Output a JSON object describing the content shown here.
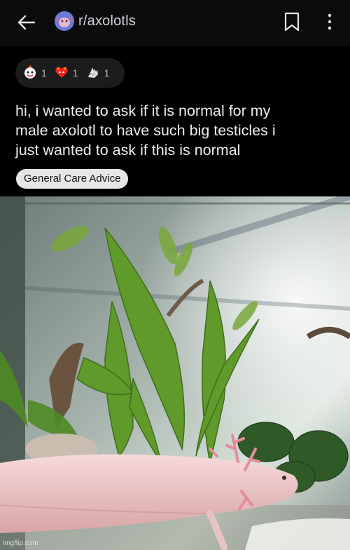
{
  "header": {
    "subreddit": "r/axolotls",
    "icons": {
      "back": "back-arrow-icon",
      "avatar": "subreddit-avatar-icon",
      "save": "bookmark-icon",
      "more": "more-options-icon"
    }
  },
  "awards": [
    {
      "icon": "award-face-icon",
      "count": "1"
    },
    {
      "icon": "award-heart-icon",
      "count": "1"
    },
    {
      "icon": "award-hand-icon",
      "count": "1"
    }
  ],
  "post": {
    "title_lines": [
      "hi, i wanted to ask if it is normal for my",
      "male axolotl to have such big testicles i",
      "just wanted to ask if this is normal"
    ],
    "flair": "General Care Advice"
  },
  "image": {
    "description_icon": "aquarium-photo",
    "watermark": "imgflip.com"
  },
  "colors": {
    "background": "#000000",
    "flair_bg": "#e6e6e6",
    "axolotl": "#f1c9c9",
    "plant": "#5f9a2a"
  }
}
